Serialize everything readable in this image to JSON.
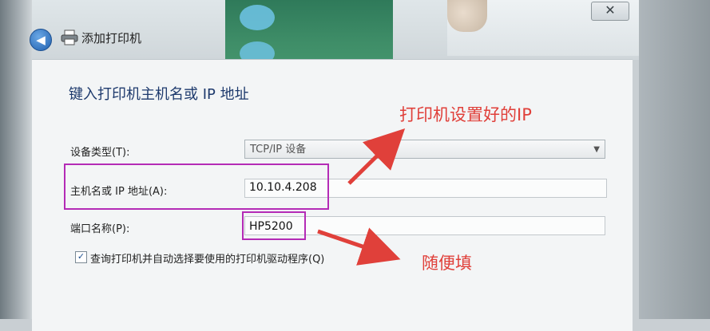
{
  "window": {
    "title": "添加打印机",
    "close_symbol": "✕"
  },
  "form": {
    "heading": "键入打印机主机名或 IP 地址",
    "device_type_label": "设备类型(T):",
    "device_type_value": "TCP/IP 设备",
    "host_label": "主机名或 IP 地址(A):",
    "host_value": "10.10.4.208",
    "port_label": "端口名称(P):",
    "port_value": "HP5200",
    "query_checkbox_label": "查询打印机并自动选择要使用的打印机驱动程序(Q)",
    "query_checked": true
  },
  "annotations": {
    "ip_note": "打印机设置好的IP",
    "port_note": "随便填",
    "color": "#e0403a",
    "box_color": "#b42bb6"
  },
  "icons": {
    "back": "back-arrow-icon",
    "printer": "printer-icon",
    "dropdown": "chevron-down-icon",
    "checkmark": "checkmark-icon"
  }
}
